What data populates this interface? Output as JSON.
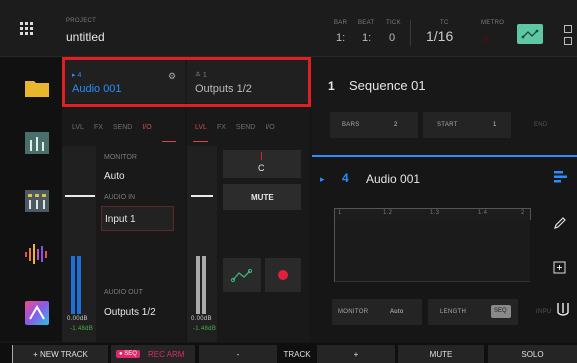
{
  "header": {
    "project_label": "PROJECT",
    "project_name": "untitled",
    "bar_label": "BAR",
    "beat_label": "BEAT",
    "tick_label": "TICK",
    "bar_value": "1:",
    "beat_value": "1:",
    "tick_value": "0",
    "tc_label": "TC",
    "tc_value": "1/16",
    "metro_label": "METRO"
  },
  "sidebar": {
    "items": [
      {
        "icon": "folder-icon"
      },
      {
        "icon": "mixer-icon"
      },
      {
        "icon": "channel-mixer-icon"
      },
      {
        "icon": "sampler-icon"
      },
      {
        "icon": "plugins-icon"
      }
    ]
  },
  "track": {
    "number": "4",
    "name": "Audio 001",
    "output_number": "1",
    "output_name": "Outputs 1/2"
  },
  "left_tabs": [
    "LVL",
    "FX",
    "SEND",
    "I/O"
  ],
  "right_tabs": [
    "LVL",
    "FX",
    "SEND",
    "I/O"
  ],
  "io": {
    "monitor_label": "MONITOR",
    "monitor_value": "Auto",
    "audio_in_label": "AUDIO IN",
    "audio_in_value": "Input 1",
    "audio_out_label": "AUDIO OUT",
    "audio_out_value": "Outputs 1/2"
  },
  "meters": {
    "left_db": "0.00dB",
    "left_peak": "-1.48dB",
    "right_db": "0.00dB",
    "right_peak": "-1.48dB"
  },
  "master": {
    "pan_value": "C",
    "mute_label": "MUTE"
  },
  "sequence": {
    "number": "1",
    "name": "Sequence 01",
    "bars_label": "BARS",
    "bars_value": "2",
    "start_label": "START",
    "start_value": "1",
    "end_label": "END"
  },
  "track_view": {
    "number": "4",
    "name": "Audio 001",
    "ruler": [
      "1",
      "1.2",
      "1.3",
      "1.4",
      "2"
    ]
  },
  "bottom_params": {
    "monitor_label": "MONITOR",
    "monitor_value": "Auto",
    "length_label": "LENGTH",
    "length_value": "SEQ",
    "input_label": "INPU"
  },
  "bottombar": {
    "new_track": "+  NEW TRACK",
    "seq_badge": "SEQ",
    "rec_arm": "REC ARM",
    "minus": "-",
    "track": "TRACK",
    "plus": "+",
    "mute": "MUTE",
    "solo": "SOLO"
  },
  "colors": {
    "accent_blue": "#2a8cff",
    "selection_red": "#e01f24",
    "meter_blue": "#1e70d8",
    "record_red": "#e3203a",
    "automation_green": "#3fb27a",
    "seq_pink": "#e0286e"
  }
}
